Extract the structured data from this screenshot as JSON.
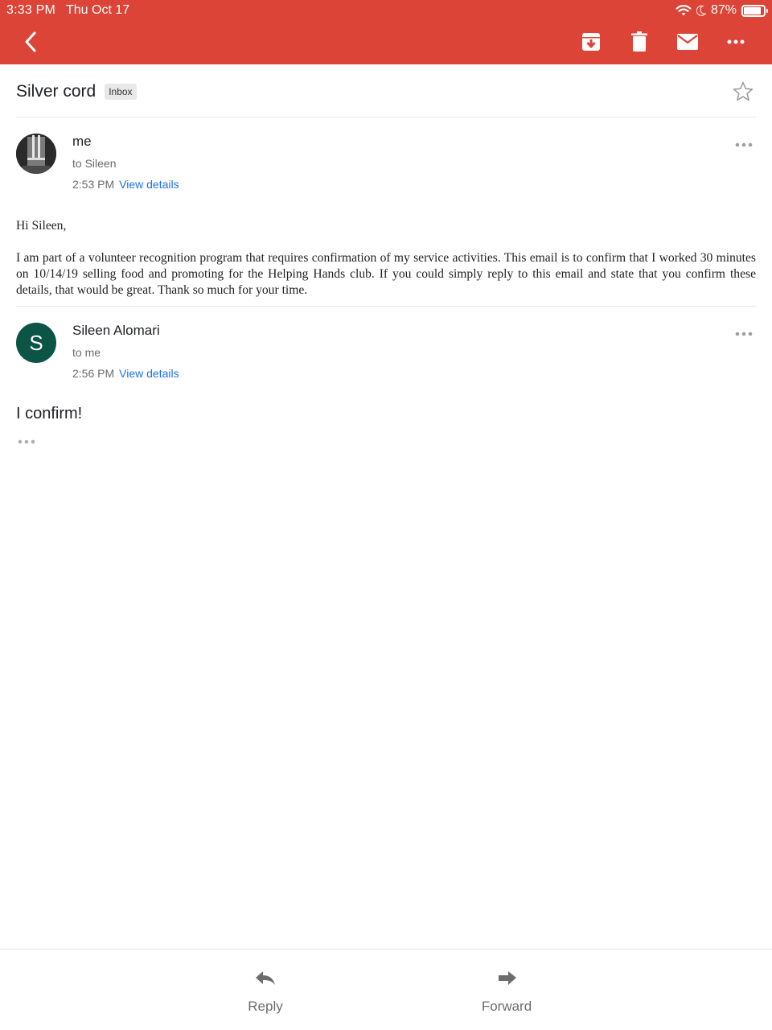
{
  "status_bar": {
    "time": "3:33 PM",
    "date": "Thu Oct 17",
    "battery": "87%",
    "battery_level": 0.87,
    "icons": [
      "wifi-icon",
      "moon-icon",
      "battery-icon"
    ]
  },
  "toolbar": {
    "color": "#db4437",
    "icons": [
      "back-arrow-icon",
      "archive-icon",
      "trash-icon",
      "mail-icon",
      "more-icon"
    ]
  },
  "thread": {
    "subject": "Silver cord",
    "label": "Inbox"
  },
  "messages": [
    {
      "sender": "me",
      "recipient": "to Sileen",
      "time": "2:53 PM",
      "view_details": "View details",
      "greeting": "Hi Sileen,",
      "body": "I am part of a volunteer recognition program that requires confirmation of my service activities. This email is to confirm that I worked 30 minutes on 10/14/19 selling food and promoting for the Helping Hands club. If you could simply reply to this email and state that you confirm these details, that would be great. Thank so much for your time."
    },
    {
      "sender": "Sileen Alomari",
      "avatar_letter": "S",
      "avatar_color": "#0b5446",
      "recipient": "to me",
      "time": "2:56 PM",
      "view_details": "View details",
      "body": "I confirm!"
    }
  ],
  "bottom_bar": {
    "reply_label": "Reply",
    "forward_label": "Forward"
  },
  "colors": {
    "accent": "#db4437",
    "link": "#1a73e8"
  }
}
